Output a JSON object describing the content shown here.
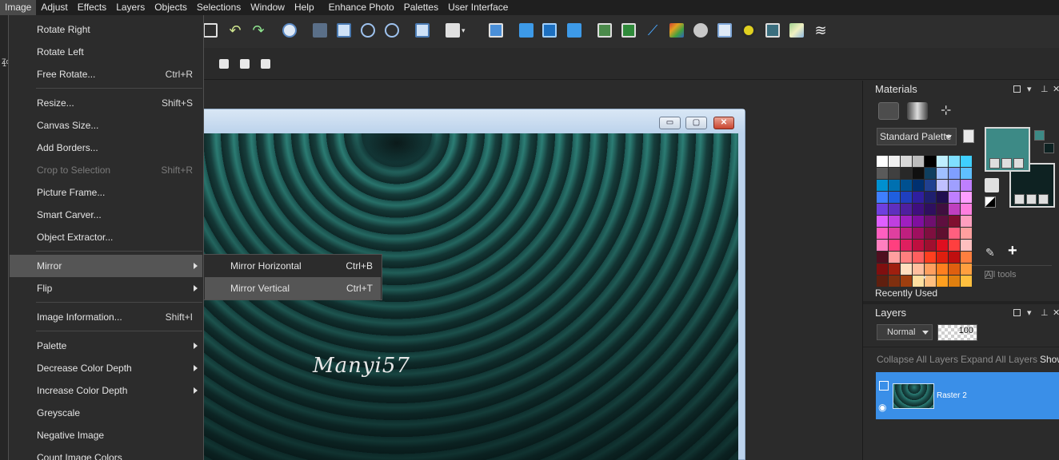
{
  "menubar": {
    "items": [
      "Image",
      "Adjust",
      "Effects",
      "Layers",
      "Objects",
      "Selections",
      "Window",
      "Help",
      "Enhance Photo",
      "Palettes",
      "User Interface"
    ]
  },
  "left_edge": {
    "zoom_label": "Zo",
    "zoom_digit": "1"
  },
  "image_menu": {
    "items": [
      {
        "label": "Rotate Right",
        "shortcut": ""
      },
      {
        "label": "Rotate Left",
        "shortcut": ""
      },
      {
        "label": "Free Rotate...",
        "shortcut": "Ctrl+R"
      },
      {
        "label": "Resize...",
        "shortcut": "Shift+S"
      },
      {
        "label": "Canvas Size...",
        "shortcut": ""
      },
      {
        "label": "Add Borders...",
        "shortcut": ""
      },
      {
        "label": "Crop to Selection",
        "shortcut": "Shift+R"
      },
      {
        "label": "Picture Frame...",
        "shortcut": ""
      },
      {
        "label": "Smart Carver...",
        "shortcut": ""
      },
      {
        "label": "Object Extractor...",
        "shortcut": ""
      },
      {
        "label": "Mirror",
        "shortcut": ""
      },
      {
        "label": "Flip",
        "shortcut": ""
      },
      {
        "label": "Image Information...",
        "shortcut": "Shift+I"
      },
      {
        "label": "Palette",
        "shortcut": ""
      },
      {
        "label": "Decrease Color Depth",
        "shortcut": ""
      },
      {
        "label": "Increase Color Depth",
        "shortcut": ""
      },
      {
        "label": "Greyscale",
        "shortcut": ""
      },
      {
        "label": "Negative Image",
        "shortcut": ""
      },
      {
        "label": "Count Image Colors",
        "shortcut": ""
      }
    ]
  },
  "mirror_submenu": {
    "items": [
      {
        "label": "Mirror Horizontal",
        "shortcut": "Ctrl+B"
      },
      {
        "label": "Mirror Vertical",
        "shortcut": "Ctrl+T"
      }
    ]
  },
  "image_window": {
    "watermark": "Manyi57",
    "buttons": {
      "minimize": "▭",
      "maximize": "▢",
      "close": "✕"
    }
  },
  "materials": {
    "title": "Materials",
    "palette_select": "Standard Palette",
    "recently_used": "Recently Used",
    "all_tools": "All tools",
    "foreground_color": "#3d8a86",
    "background_color": "#0e2222",
    "swatches": [
      "#ffffff",
      "#f0f0f0",
      "#d8d8d8",
      "#bdbdbd",
      "#000000",
      "#bfefff",
      "#7fdfff",
      "#3fcfff",
      "#5a5a5a",
      "#404040",
      "#282828",
      "#101010",
      "#0f3f5f",
      "#9fbfff",
      "#7f9fff",
      "#5fbfff",
      "#0090d0",
      "#0070b0",
      "#005090",
      "#003070",
      "#204090",
      "#bfbfff",
      "#9f9fff",
      "#bf7fff",
      "#3f7fff",
      "#1f5fdf",
      "#1f3fbf",
      "#2f1f9f",
      "#1f1f6f",
      "#1f0f4f",
      "#bf7fff",
      "#ff9fff",
      "#6f3fdf",
      "#5f2fbf",
      "#4f1f9f",
      "#3f0f7f",
      "#2f0f5f",
      "#3f0f3f",
      "#bf3fbf",
      "#ff7fdf",
      "#df5fff",
      "#bf3fdf",
      "#9f1fbf",
      "#7f0f9f",
      "#6f0f6f",
      "#5f0f3f",
      "#7f0f2f",
      "#ff9fbf",
      "#ff5fbf",
      "#df3f9f",
      "#bf1f7f",
      "#9f0f5f",
      "#7f0f3f",
      "#5f0f2f",
      "#ff5f7f",
      "#ff9f9f",
      "#ff7fbf",
      "#ff3f7f",
      "#df1f5f",
      "#bf0f3f",
      "#9f0f2f",
      "#df0f1f",
      "#ff3f3f",
      "#ffbfbf",
      "#4f0f1f",
      "#ff9f9f",
      "#ff7f7f",
      "#ff5f5f",
      "#ff3f1f",
      "#df1f0f",
      "#bf0f0f",
      "#ff7f3f",
      "#7f0f0f",
      "#9f1f0f",
      "#ffdfbf",
      "#ffbf9f",
      "#ff9f5f",
      "#ff7f1f",
      "#df5f0f",
      "#ff9f3f",
      "#5f1f0f",
      "#7f2f0f",
      "#9f3f0f",
      "#ffdf9f",
      "#ffbf7f",
      "#ff9f1f",
      "#df7f0f",
      "#ffbf3f"
    ]
  },
  "layers": {
    "title": "Layers",
    "blend_mode": "Normal",
    "opacity": "100",
    "actions": [
      "Collapse All Layers",
      "Expand All Layers",
      "Show"
    ],
    "layer_name": "Raster 2"
  }
}
